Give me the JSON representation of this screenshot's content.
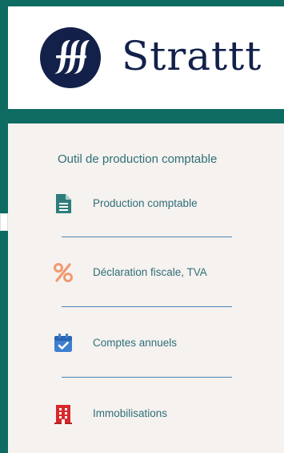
{
  "brand": {
    "name": "Strattt",
    "logo_icon": "stylized-fff-logo"
  },
  "panel": {
    "title": "Outil de production comptable",
    "items": [
      {
        "label": "Production comptable",
        "icon": "document-icon",
        "color": "#2f7d7b"
      },
      {
        "label": "Déclaration fiscale, TVA",
        "icon": "percent-icon",
        "color": "#ef9a73"
      },
      {
        "label": "Comptes annuels",
        "icon": "calendar-check-icon",
        "color": "#3d7fd0"
      },
      {
        "label": "Immobilisations",
        "icon": "building-icon",
        "color": "#d8282b"
      }
    ]
  },
  "colors": {
    "frame": "#0d6b61",
    "brand_navy": "#13214a",
    "panel_bg": "#f6f2ef",
    "text": "#2f6f78",
    "divider": "#4d86b8"
  }
}
